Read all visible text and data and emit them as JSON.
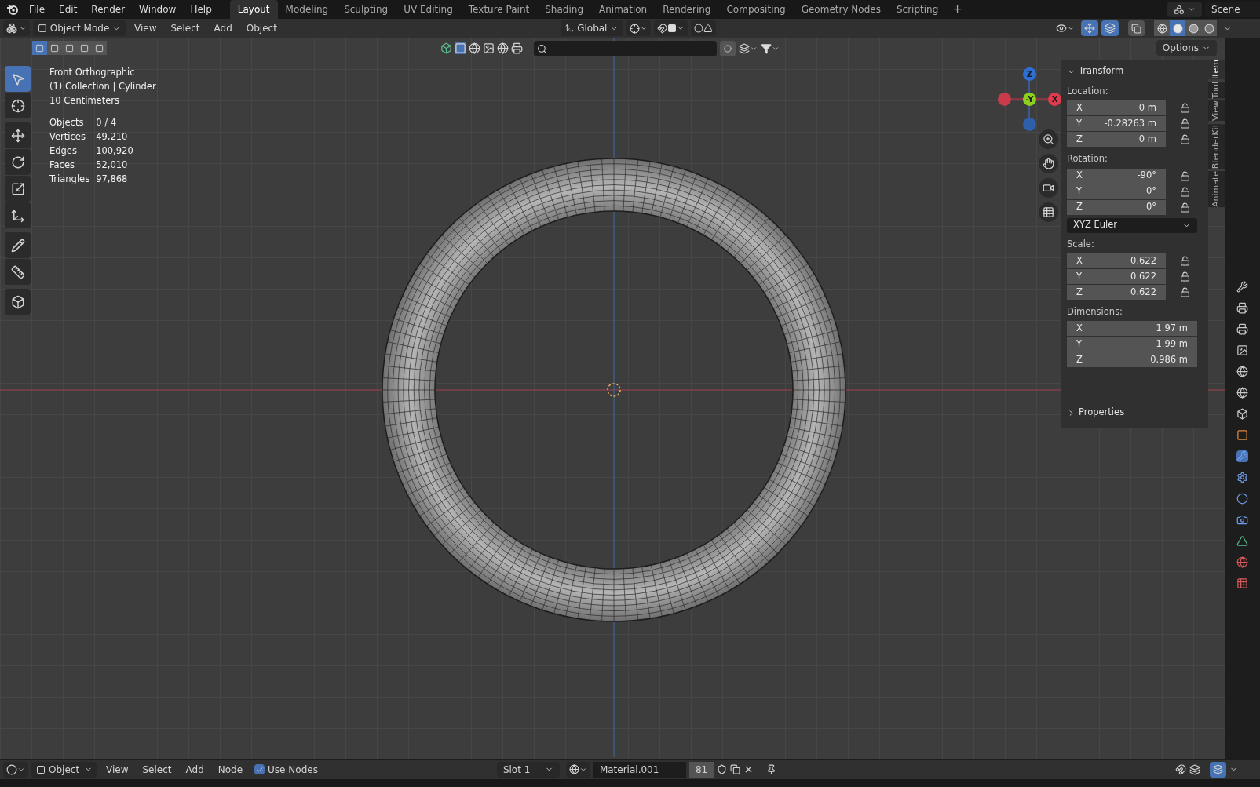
{
  "menu": [
    "File",
    "Edit",
    "Render",
    "Window",
    "Help"
  ],
  "workspaces": [
    {
      "label": "Layout",
      "selected": true
    },
    {
      "label": "Modeling",
      "selected": false
    },
    {
      "label": "Sculpting",
      "selected": false
    },
    {
      "label": "UV Editing",
      "selected": false
    },
    {
      "label": "Texture Paint",
      "selected": false
    },
    {
      "label": "Shading",
      "selected": false
    },
    {
      "label": "Animation",
      "selected": false
    },
    {
      "label": "Rendering",
      "selected": false
    },
    {
      "label": "Compositing",
      "selected": false
    },
    {
      "label": "Geometry Nodes",
      "selected": false
    },
    {
      "label": "Scripting",
      "selected": false
    }
  ],
  "add_workspace": "+",
  "scene": "Scene",
  "header": {
    "mode": "Object Mode",
    "menus": [
      "View",
      "Select",
      "Add",
      "Object"
    ],
    "orientation": "Global"
  },
  "select_modes": [
    {
      "selected": true
    },
    {
      "selected": false
    },
    {
      "selected": false
    },
    {
      "selected": false
    },
    {
      "selected": false
    }
  ],
  "shading": [
    {
      "kind": "wireframe",
      "selected": false
    },
    {
      "kind": "solid",
      "selected": true
    },
    {
      "kind": "material",
      "selected": false
    },
    {
      "kind": "rendered",
      "selected": false
    }
  ],
  "options": "Options",
  "viewport": {
    "title": "Front Orthographic",
    "collection": "(1) Collection | Cylinder",
    "scale": "10 Centimeters",
    "stats": [
      {
        "label": "Objects",
        "value": "0 / 4"
      },
      {
        "label": "Vertices",
        "value": "49,210"
      },
      {
        "label": "Edges",
        "value": "100,920"
      },
      {
        "label": "Faces",
        "value": "52,010"
      },
      {
        "label": "Triangles",
        "value": "97,868"
      }
    ]
  },
  "tools": [
    {
      "kind": "select",
      "selected": true
    },
    {
      "kind": "cursor",
      "selected": false
    },
    {
      "kind": "move",
      "selected": false
    },
    {
      "kind": "rotate",
      "selected": false
    },
    {
      "kind": "scale",
      "selected": false
    },
    {
      "kind": "transform",
      "selected": false
    },
    {
      "kind": "annotate",
      "selected": false
    },
    {
      "kind": "measure",
      "selected": false
    },
    {
      "kind": "add_cube",
      "selected": false
    }
  ],
  "gizmo": [
    {
      "label": "Z",
      "color": "#2e6fd6"
    },
    {
      "color": "#c93a4a"
    },
    {
      "label": "-Y",
      "color": "#8ccf1f"
    },
    {
      "label": "X",
      "color": "#e03a4e"
    },
    {
      "color": "#2e5fa8"
    }
  ],
  "sidebar": {
    "panel": {
      "label": "Transform",
      "expanded": true
    },
    "sections": [
      {
        "label": "Location:",
        "fields": [
          {
            "axis": "X",
            "value": "0 m",
            "locked": false
          },
          {
            "axis": "Y",
            "value": "-0.28263 m",
            "locked": false
          },
          {
            "axis": "Z",
            "value": "0 m",
            "locked": false
          }
        ]
      },
      {
        "label": "Rotation:",
        "fields": [
          {
            "axis": "X",
            "value": "-90°",
            "locked": false
          },
          {
            "axis": "Y",
            "value": "-0°",
            "locked": false
          },
          {
            "axis": "Z",
            "value": "0°",
            "locked": false
          }
        ],
        "mode": "XYZ Euler"
      },
      {
        "label": "Scale:",
        "fields": [
          {
            "axis": "X",
            "value": "0.622",
            "locked": false
          },
          {
            "axis": "Y",
            "value": "0.622",
            "locked": false
          },
          {
            "axis": "Z",
            "value": "0.622",
            "locked": false
          }
        ]
      },
      {
        "label": "Dimensions:",
        "fields": [
          {
            "axis": "X",
            "value": "1.97 m"
          },
          {
            "axis": "Y",
            "value": "1.99 m"
          },
          {
            "axis": "Z",
            "value": "0.986 m"
          }
        ]
      }
    ],
    "properties": {
      "label": "Properties",
      "expanded": false
    }
  },
  "sidebar_tabs": [
    {
      "label": "Item",
      "selected": true
    },
    {
      "label": "Tool",
      "selected": false
    },
    {
      "label": "View",
      "selected": false
    },
    {
      "label": "BlenderKit",
      "selected": false
    },
    {
      "label": "Animate",
      "selected": false
    }
  ],
  "bottom": {
    "editor": "Object",
    "menus": [
      "View",
      "Select",
      "Add",
      "Node"
    ],
    "use_nodes": {
      "label": "Use Nodes",
      "checked": true
    },
    "slot": "Slot 1",
    "material": "Material.001",
    "users": "81"
  }
}
